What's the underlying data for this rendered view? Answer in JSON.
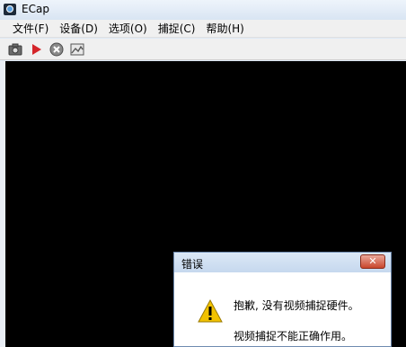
{
  "window": {
    "title": "ECap"
  },
  "menu": [
    {
      "label": "文件(F)"
    },
    {
      "label": "设备(D)"
    },
    {
      "label": "选项(O)"
    },
    {
      "label": "捕捉(C)"
    },
    {
      "label": "帮助(H)"
    }
  ],
  "toolbar": {
    "icons": [
      "camera-icon",
      "play-icon",
      "stop-icon",
      "image-icon"
    ]
  },
  "dialog": {
    "title": "错误",
    "close_label": "✕",
    "message_line1": "抱歉, 没有视频捕捉硬件。",
    "message_line2": "视频捕捉不能正确作用。",
    "icon": "warning-icon"
  },
  "colors": {
    "video_background": "#000000",
    "close_button": "#c9462c",
    "warning_icon": "#f2c200"
  }
}
